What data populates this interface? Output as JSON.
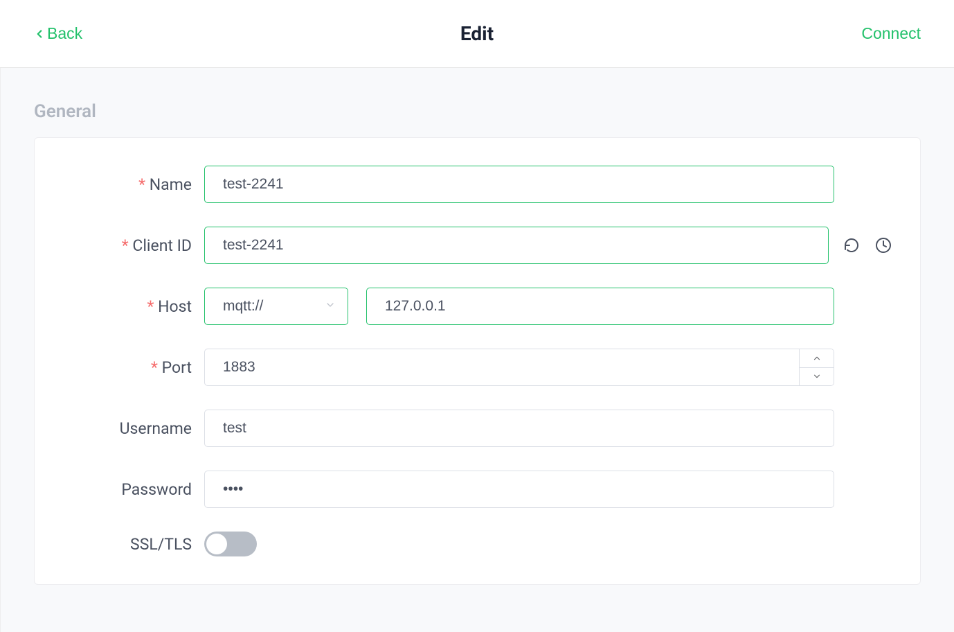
{
  "header": {
    "back_label": "Back",
    "page_title": "Edit",
    "connect_label": "Connect"
  },
  "section": {
    "general_title": "General"
  },
  "form": {
    "name": {
      "label": "Name",
      "value": "test-2241"
    },
    "client_id": {
      "label": "Client ID",
      "value": "test-2241"
    },
    "host": {
      "label": "Host",
      "protocol": "mqtt://",
      "address": "127.0.0.1"
    },
    "port": {
      "label": "Port",
      "value": "1883"
    },
    "username": {
      "label": "Username",
      "value": "test"
    },
    "password": {
      "label": "Password",
      "value": "••••"
    },
    "ssl": {
      "label": "SSL/TLS",
      "enabled": false
    }
  }
}
